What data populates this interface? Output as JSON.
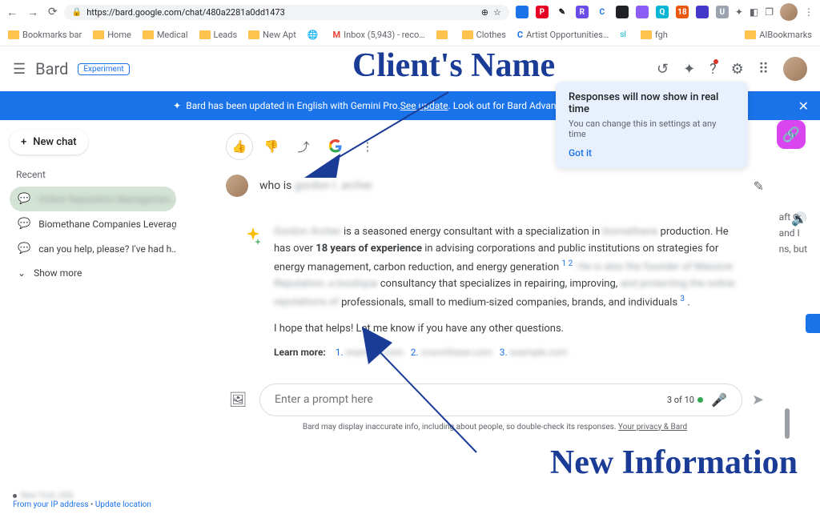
{
  "browser": {
    "url": "https://bard.google.com/chat/480a2281a0dd1473",
    "extensions": [
      {
        "bg": "#1a73e8",
        "txt": "",
        "c": "#fff"
      },
      {
        "bg": "#e60023",
        "txt": "P",
        "c": "#fff"
      },
      {
        "bg": "#fff",
        "txt": "✎",
        "c": "#000"
      },
      {
        "bg": "#6b4ce6",
        "txt": "R",
        "c": "#fff"
      },
      {
        "bg": "#fff",
        "txt": "C",
        "c": "#1a73e8"
      },
      {
        "bg": "#202124",
        "txt": "",
        "c": "#fff"
      },
      {
        "bg": "#8b5cf6",
        "txt": "",
        "c": "#fff"
      },
      {
        "bg": "#06b6d4",
        "txt": "Q",
        "c": "#fff"
      },
      {
        "bg": "#ea580c",
        "txt": "18",
        "c": "#fff"
      },
      {
        "bg": "#4338ca",
        "txt": "",
        "c": "#fff"
      },
      {
        "bg": "#9ca3af",
        "txt": "U",
        "c": "#fff"
      }
    ]
  },
  "bookmarks": [
    {
      "label": "Bookmarks bar",
      "type": "folder"
    },
    {
      "label": "Home",
      "type": "folder"
    },
    {
      "label": "Medical",
      "type": "folder"
    },
    {
      "label": "Leads",
      "type": "folder"
    },
    {
      "label": "New Apt",
      "type": "folder"
    },
    {
      "label": "",
      "type": "globe"
    },
    {
      "label": "Inbox (5,943) - reco…",
      "type": "gmail"
    },
    {
      "label": "",
      "type": "folder"
    },
    {
      "label": "Clothes",
      "type": "folder"
    },
    {
      "label": "Artist Opportunities…",
      "type": "c"
    },
    {
      "label": "",
      "type": "sl"
    },
    {
      "label": "fgh",
      "type": "folder"
    }
  ],
  "bookmarks_right": {
    "label": "AIBookmarks"
  },
  "header": {
    "logo": "Bard",
    "badge": "Experiment"
  },
  "banner": {
    "text_pre": "Bard has been updated in English with Gemini Pro. ",
    "link": "See update",
    "text_post": ". Look out for Bard Advanced with Gemini Ultra"
  },
  "toast": {
    "title": "Responses will now show in real time",
    "body": "You can change this in settings at any time",
    "btn": "Got it"
  },
  "sidebar": {
    "new_chat": "New chat",
    "recent_label": "Recent",
    "items": [
      {
        "label": "Online Reputation Managemen…",
        "active": true,
        "blurred": true
      },
      {
        "label": "Biomethane Companies Leverag…",
        "active": false,
        "blurred": false
      },
      {
        "label": "can you help, please? I've had h…",
        "active": false,
        "blurred": false
      }
    ],
    "show_more": "Show more"
  },
  "location": {
    "place": "New York, USA",
    "from": "From your IP address",
    "update": "Update location"
  },
  "prompt": {
    "prefix": "who is ",
    "name": "gordon l. archer"
  },
  "response": {
    "part1_blurred": "Gordon    Archer ",
    "part1": "is a seasoned energy consultant with a specialization in ",
    "part1_blurred2": "biomethane",
    "part1_end": " production. He has over ",
    "bold": "18 years of experience",
    "part2": " in advising corporations and public institutions on strategies for energy management, carbon reduction, and energy generation ",
    "sup1": "1  2",
    "part3": ". He is also the founder of Massive Reputation, a boutique",
    "part3_plain": " consultancy that specializes in repairing, improving, ",
    "part3_blurred": "and protecting the online reputations of",
    "part4": " professionals, small to medium-sized companies, brands, and individuals ",
    "sup2": "3",
    "followup": "I hope that helps! Let me know if you have any other questions.",
    "learn_label": "Learn more:",
    "sources": [
      {
        "n": "1",
        "domain": "example.com"
      },
      {
        "n": "2",
        "domain": "crunchbase.com"
      },
      {
        "n": "3",
        "domain": "example.com"
      }
    ]
  },
  "drafts": {
    "label": "aft",
    "text": "and I",
    "text2": "ns, but"
  },
  "input": {
    "placeholder": "Enter a prompt here",
    "counter": "3 of 10"
  },
  "footer": {
    "text": "Bard may display inaccurate info, including about people, so double-check its responses. ",
    "link": "Your privacy & Bard"
  },
  "annotations": {
    "top": "Client's Name",
    "bottom": "New Information"
  }
}
